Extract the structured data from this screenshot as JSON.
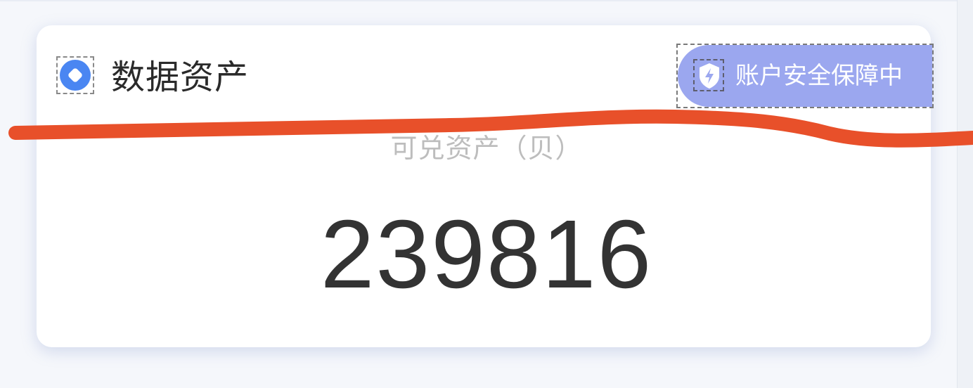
{
  "card": {
    "title": "数据资产",
    "logo_icon": "app-logo-icon"
  },
  "badge": {
    "label": "账户安全保障中",
    "icon": "shield-bolt-icon",
    "color": "#9ba7ef"
  },
  "asset": {
    "caption": "可兑资产（贝）",
    "value": "239816"
  },
  "annotation": {
    "stroke_color": "#e8502a"
  },
  "colors": {
    "accent": "#4a86f2",
    "badge_bg": "#9ba7ef"
  }
}
